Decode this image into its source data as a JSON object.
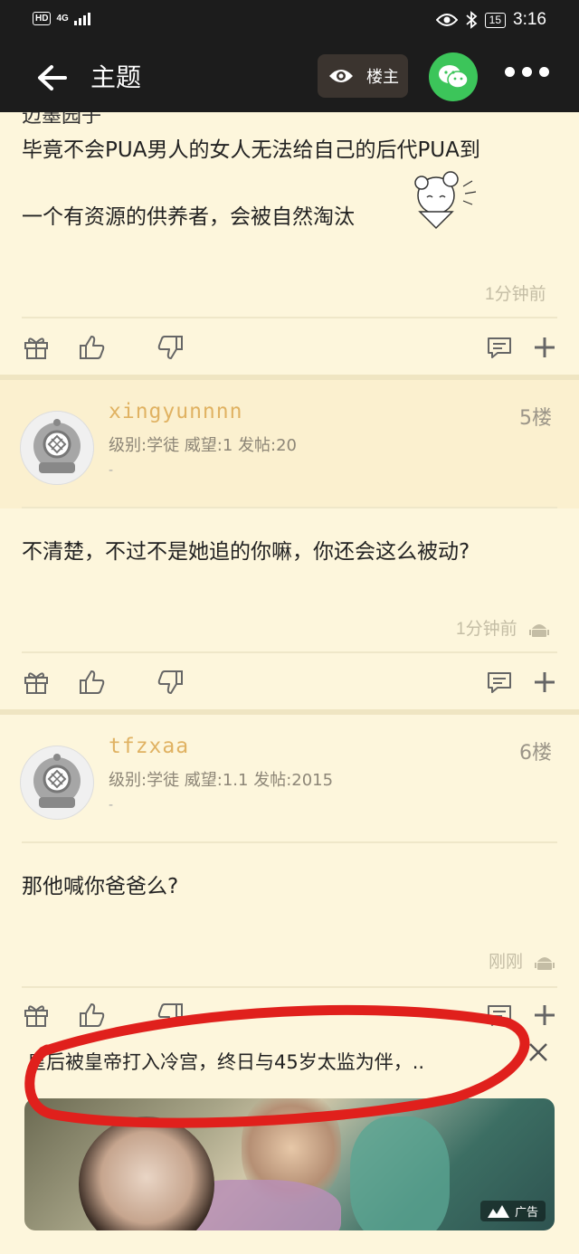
{
  "status_bar": {
    "hd": "HD",
    "network": "4G",
    "battery": "15",
    "time": "3:16"
  },
  "header": {
    "title": "主题",
    "louzhu_label": "楼主"
  },
  "post_top": {
    "cut_text": "迈墨园子",
    "text_line1": "毕竟不会PUA男人的女人无法给自己的后代PUA到",
    "text_line2": "一个有资源的供养者，会被自然淘汰",
    "time": "1分钟前"
  },
  "replies": [
    {
      "username": "xingyunnnn",
      "info": "级别:学徒 威望:1 发帖:20",
      "dash": "-",
      "floor": "5楼",
      "text": "不清楚，不过不是她追的你嘛，你还会这么被动?",
      "time": "1分钟前"
    },
    {
      "username": "tfzxaa",
      "info": "级别:学徒 威望:1.1 发帖:2015",
      "dash": "-",
      "floor": "6楼",
      "text": "那他喊你爸爸么?",
      "time": "刚刚"
    }
  ],
  "ad": {
    "title": "皇后被皇帝打入冷宫，终日与45岁太监为伴，..",
    "badge": "广告"
  },
  "colors": {
    "background": "#fdf6dc",
    "header": "#1c1c1c",
    "wechat": "#3cc55a",
    "username": "#e0b262",
    "annotation": "#e0201c"
  }
}
